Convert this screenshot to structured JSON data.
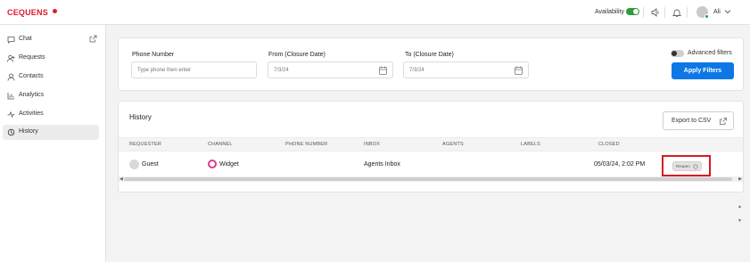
{
  "header": {
    "logo": "CEQUENS",
    "availability_label": "Availability",
    "username": "Ali"
  },
  "sidebar": {
    "items": [
      {
        "label": "Chat",
        "icon": "chat-bubble-icon"
      },
      {
        "label": "Requests",
        "icon": "add-user-icon"
      },
      {
        "label": "Contacts",
        "icon": "contacts-icon"
      },
      {
        "label": "Analytics",
        "icon": "bar-chart-icon"
      },
      {
        "label": "Activities",
        "icon": "pulse-icon"
      },
      {
        "label": "History",
        "icon": "history-icon"
      }
    ],
    "active": "History"
  },
  "filters": {
    "phone_label": "Phone Number",
    "phone_placeholder": "Type phone then enter",
    "from_label": "From (Closure Date)",
    "from_value": "7/3/24",
    "to_label": "To (Closure Date)",
    "to_value": "7/3/24",
    "advanced_label": "Advanced filters",
    "apply_label": "Apply Filters"
  },
  "history": {
    "title": "History",
    "export_label": "Export to CSV",
    "columns": [
      "REQUESTER",
      "CHANNEL",
      "PHONE NUMBER",
      "INBOX",
      "AGENTS",
      "LABELS",
      "CLOSED"
    ],
    "rows": [
      {
        "requester": "Guest",
        "channel": "Widget",
        "phone": "",
        "inbox": "Agents Inbox",
        "agents": "",
        "labels": "",
        "closed": "05/03/24, 2:02 PM",
        "action": "Reopen"
      }
    ]
  },
  "colors": {
    "brand": "#e0192e",
    "primary": "#0d77e6",
    "online": "#2e9b3c",
    "highlight": "#d71920"
  }
}
